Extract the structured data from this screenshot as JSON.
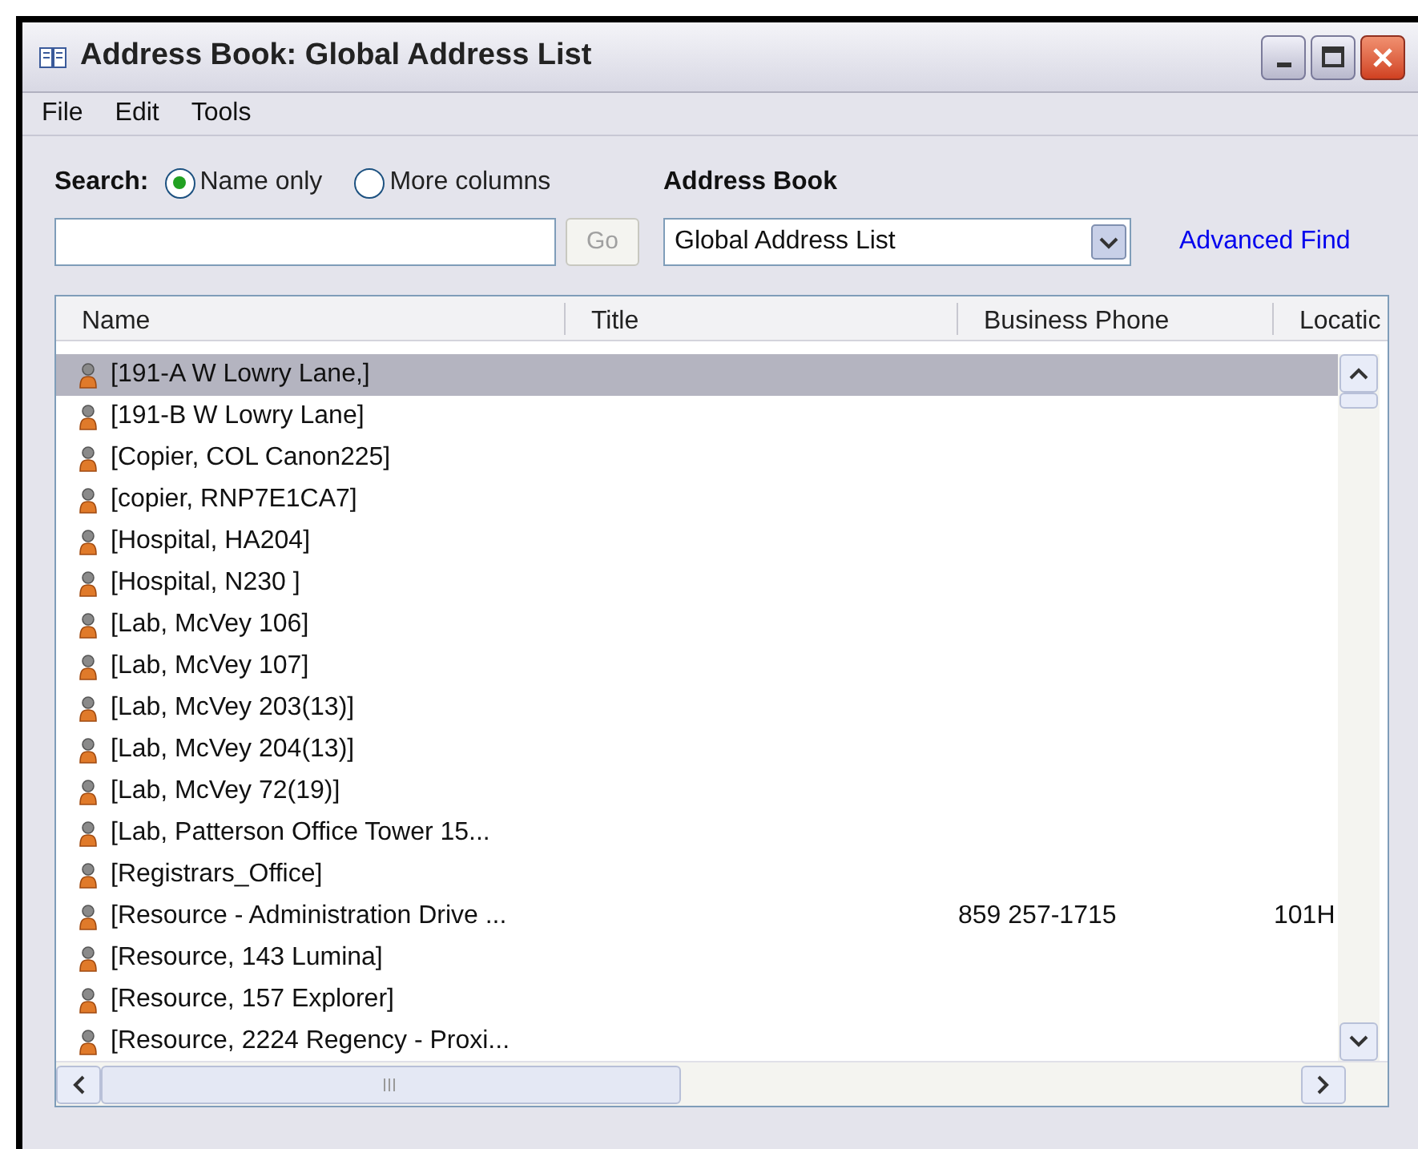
{
  "window": {
    "title": "Address Book: Global Address List"
  },
  "menu": [
    "File",
    "Edit",
    "Tools"
  ],
  "search": {
    "label": "Search:",
    "options": [
      {
        "label": "Name only",
        "selected": true
      },
      {
        "label": "More columns",
        "selected": false
      }
    ],
    "go": "Go"
  },
  "address_book": {
    "label": "Address Book",
    "value": "Global Address List",
    "advanced_find": "Advanced Find"
  },
  "table": {
    "columns": [
      "Name",
      "Title",
      "Business Phone",
      "Locatic"
    ],
    "rows": [
      {
        "name": "[191-A W Lowry Lane,]",
        "selected": true
      },
      {
        "name": "[191-B W Lowry Lane]",
        "selected": false
      },
      {
        "name": "[Copier, COL Canon225]",
        "selected": false
      },
      {
        "name": "[copier, RNP7E1CA7]",
        "selected": false
      },
      {
        "name": "[Hospital, HA204]",
        "selected": false
      },
      {
        "name": "[Hospital, N230 ]",
        "selected": false
      },
      {
        "name": "[Lab, McVey 106]",
        "selected": false
      },
      {
        "name": "[Lab, McVey 107]",
        "selected": false
      },
      {
        "name": "[Lab, McVey 203(13)]",
        "selected": false
      },
      {
        "name": "[Lab, McVey 204(13)]",
        "selected": false
      },
      {
        "name": "[Lab, McVey 72(19)]",
        "selected": false
      },
      {
        "name": "[Lab, Patterson Office Tower 15...",
        "selected": false
      },
      {
        "name": "[Registrars_Office]",
        "selected": false
      },
      {
        "name": "[Resource - Administration Drive ...",
        "phone": "859 257-1715",
        "location": "101H",
        "selected": false
      },
      {
        "name": "[Resource, 143 Lumina]",
        "selected": false
      },
      {
        "name": "[Resource, 157 Explorer]",
        "selected": false
      },
      {
        "name": "[Resource, 2224 Regency - Proxi...",
        "selected": false
      }
    ]
  }
}
